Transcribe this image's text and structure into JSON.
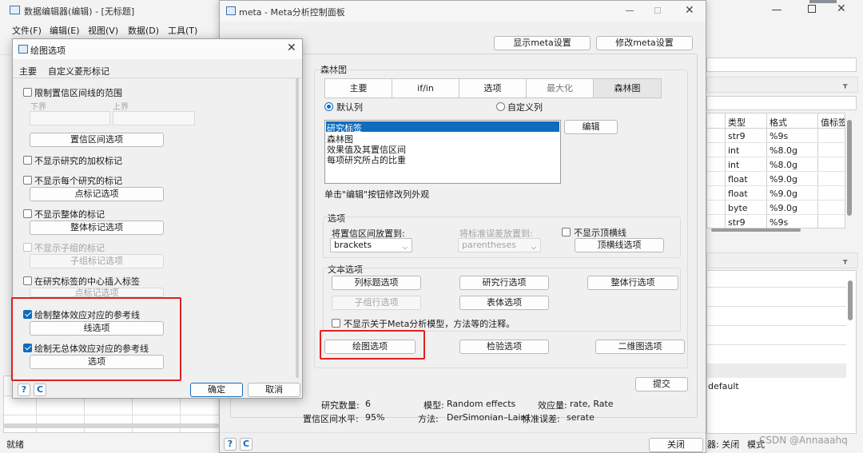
{
  "main_window": {
    "title": "数据编辑器(编辑) - [无标题]",
    "menu": [
      "文件(F)",
      "编辑(E)",
      "视图(V)",
      "数据(D)",
      "工具(T)"
    ],
    "status": "就绪",
    "status_right": [
      "器: 关闭",
      "模式"
    ],
    "watermark": "CSDN @Annaaahq",
    "props_table": {
      "headers": [
        "类型",
        "格式",
        "值标签"
      ],
      "rows": [
        [
          "str9",
          "%9s"
        ],
        [
          "int",
          "%8.0g"
        ],
        [
          "int",
          "%8.0g"
        ],
        [
          "float",
          "%9.0g"
        ],
        [
          "float",
          "%9.0g"
        ],
        [
          "byte",
          "%9.0g"
        ],
        [
          "str9",
          "%9s"
        ]
      ]
    },
    "default_text": "default",
    "pin1": "ᚁ",
    "pin2": "ᚁ"
  },
  "meta": {
    "title": "meta - Meta分析控制面板",
    "show_settings": "显示meta设置",
    "modify_settings": "修改meta设置",
    "forest_group": "森林图",
    "tabs": [
      "主要",
      "if/in",
      "选项",
      "最大化",
      "森林图"
    ],
    "radio_default": "默认列",
    "radio_custom": "自定义列",
    "list_items": [
      "研究标签",
      "森林图",
      "效果值及其置信区间",
      "每项研究所占的比重"
    ],
    "edit_button": "编辑",
    "hint": "单击\"编辑\"按钮修改列外观",
    "options_group": "选项",
    "ci_place_label": "将置信区间放置到:",
    "ci_place_value": "brackets",
    "se_place_label": "将标准误差放置到:",
    "se_place_value": "parentheses",
    "no_top_line": "不显示顶横线",
    "top_line_options": "顶横线选项",
    "text_options_group": "文本选项",
    "col_title_options": "列标题选项",
    "study_row_options": "研究行选项",
    "overall_row_options": "整体行选项",
    "subgroup_row_options": "子组行选项",
    "table_options": "表体选项",
    "no_model_note": "不显示关于Meta分析模型，方法等的注释。",
    "plot_options": "绘图选项",
    "test_options": "检验选项",
    "twoway_options": "二维图选项",
    "submit": "提交",
    "close": "关闭",
    "summary": {
      "n_studies_label": "研究数量:",
      "n_studies": "6",
      "model_label": "模型:",
      "model": "Random effects",
      "effect_label": "效应量:",
      "effect": "rate, Rate",
      "ci_label": "置信区间水平:",
      "ci": "95%",
      "method_label": "方法:",
      "method": "DerSimonian–Laird",
      "se_label": "标准误差:",
      "se": "serate"
    }
  },
  "plot": {
    "title": "绘图选项",
    "tabs": [
      "主要",
      "自定义菱形标记"
    ],
    "limit_ci": "限制置信区间线的范围",
    "lower": "下界",
    "upper": "上界",
    "ci_line_options": "置信区间选项",
    "no_weight_marker": "不显示研究的加权标记",
    "no_study_marker": "不显示每个研究的标记",
    "point_marker_options": "点标记选项",
    "no_overall_marker": "不显示整体的标记",
    "overall_marker_options": "整体标记选项",
    "no_subgroup_marker": "不显示子组的标记",
    "subgroup_marker_options": "子组标记选项",
    "insert_center_label": "在研究标签的中心插入标签",
    "point_marker_options2": "点标记选项",
    "draw_overall_ref": "绘制整体效应对应的参考线",
    "line_options": "线选项",
    "draw_null_ref": "绘制无总体效应对应的参考线",
    "options": "选项",
    "ok": "确定",
    "cancel": "取消",
    "help": "?",
    "reset": "C"
  },
  "accent": "#0f6cbd",
  "highlight": "#e02020"
}
